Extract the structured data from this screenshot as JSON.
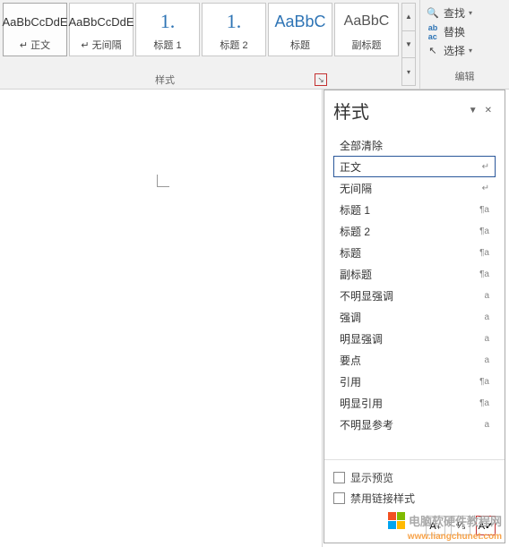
{
  "ribbon": {
    "styles_group_label": "样式",
    "tiles": [
      {
        "preview": "AaBbCcDdE",
        "label": "正文",
        "cls": ""
      },
      {
        "preview": "AaBbCcDdE",
        "label": "无间隔",
        "cls": ""
      },
      {
        "preview": "1.",
        "label": "标题 1",
        "cls": "big"
      },
      {
        "preview": "1.",
        "label": "标题 2",
        "cls": "big"
      },
      {
        "preview": "AaBbC",
        "label": "标题",
        "cls": "heading"
      },
      {
        "preview": "AaBbC",
        "label": "副标题",
        "cls": "heading2"
      }
    ],
    "edit": {
      "find": "查找",
      "replace": "替换",
      "select": "选择",
      "label": "编辑"
    }
  },
  "pane": {
    "title": "样式",
    "items": [
      {
        "text": "全部清除",
        "mark": ""
      },
      {
        "text": "正文",
        "mark": "↵",
        "sel": true
      },
      {
        "text": "无间隔",
        "mark": "↵"
      },
      {
        "text": "标题 1",
        "mark": "¶a"
      },
      {
        "text": "标题 2",
        "mark": "¶a"
      },
      {
        "text": "标题",
        "mark": "¶a"
      },
      {
        "text": "副标题",
        "mark": "¶a"
      },
      {
        "text": "不明显强调",
        "mark": "a"
      },
      {
        "text": "强调",
        "mark": "a"
      },
      {
        "text": "明显强调",
        "mark": "a"
      },
      {
        "text": "要点",
        "mark": "a"
      },
      {
        "text": "引用",
        "mark": "¶a"
      },
      {
        "text": "明显引用",
        "mark": "¶a"
      },
      {
        "text": "不明显参考",
        "mark": "a"
      }
    ],
    "show_preview": "显示预览",
    "disable_linked": "禁用链接样式"
  },
  "watermark": {
    "main": "电脑软硬件教程网",
    "sub": "www.liangchunet.com"
  }
}
